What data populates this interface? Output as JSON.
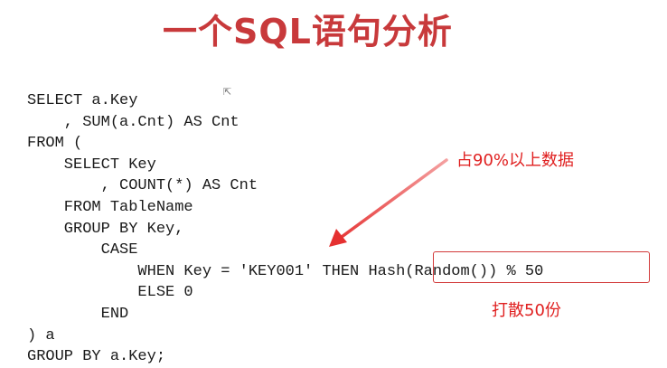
{
  "title": "一个SQL语句分析",
  "code_lines": [
    "SELECT a.Key",
    "    , SUM(a.Cnt) AS Cnt",
    "FROM (",
    "    SELECT Key",
    "        , COUNT(*) AS Cnt",
    "    FROM TableName",
    "    GROUP BY Key,",
    "        CASE",
    "            WHEN Key = 'KEY001' THEN Hash(Random()) % 50",
    "            ELSE 0",
    "        END",
    ") a",
    "GROUP BY a.Key;"
  ],
  "annotations": {
    "top": "占90%以上数据",
    "bottom": "打散50份"
  },
  "colors": {
    "title": "#c8393b",
    "annotation": "#e02020",
    "arrow": "#e53030",
    "highlight_border": "#d23a3a"
  },
  "icons": {
    "cursor": "mouse-pointer-icon"
  }
}
